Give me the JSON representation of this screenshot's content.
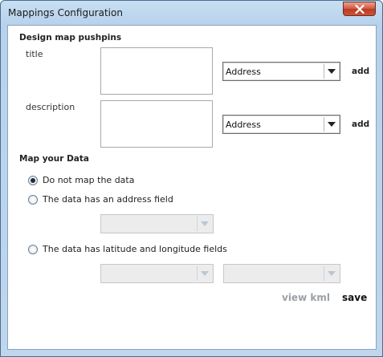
{
  "window": {
    "title": "Mappings Configuration"
  },
  "design": {
    "heading": "Design map pushpins",
    "title_label": "title",
    "description_label": "description",
    "title_combo_value": "Address",
    "description_combo_value": "Address",
    "add_label": "add"
  },
  "map_data": {
    "heading": "Map your Data",
    "options": [
      {
        "label": "Do not map the data",
        "selected": true
      },
      {
        "label": "The data has an address field",
        "selected": false
      },
      {
        "label": "The data has latitude and longitude fields",
        "selected": false
      }
    ]
  },
  "footer": {
    "view_kml": "view kml",
    "save": "save"
  },
  "icons": {
    "close": "close-icon",
    "dropdown": "chevron-down-icon"
  },
  "colors": {
    "close_button": "#d0553f",
    "disabled_link": "#9aa0a6"
  }
}
